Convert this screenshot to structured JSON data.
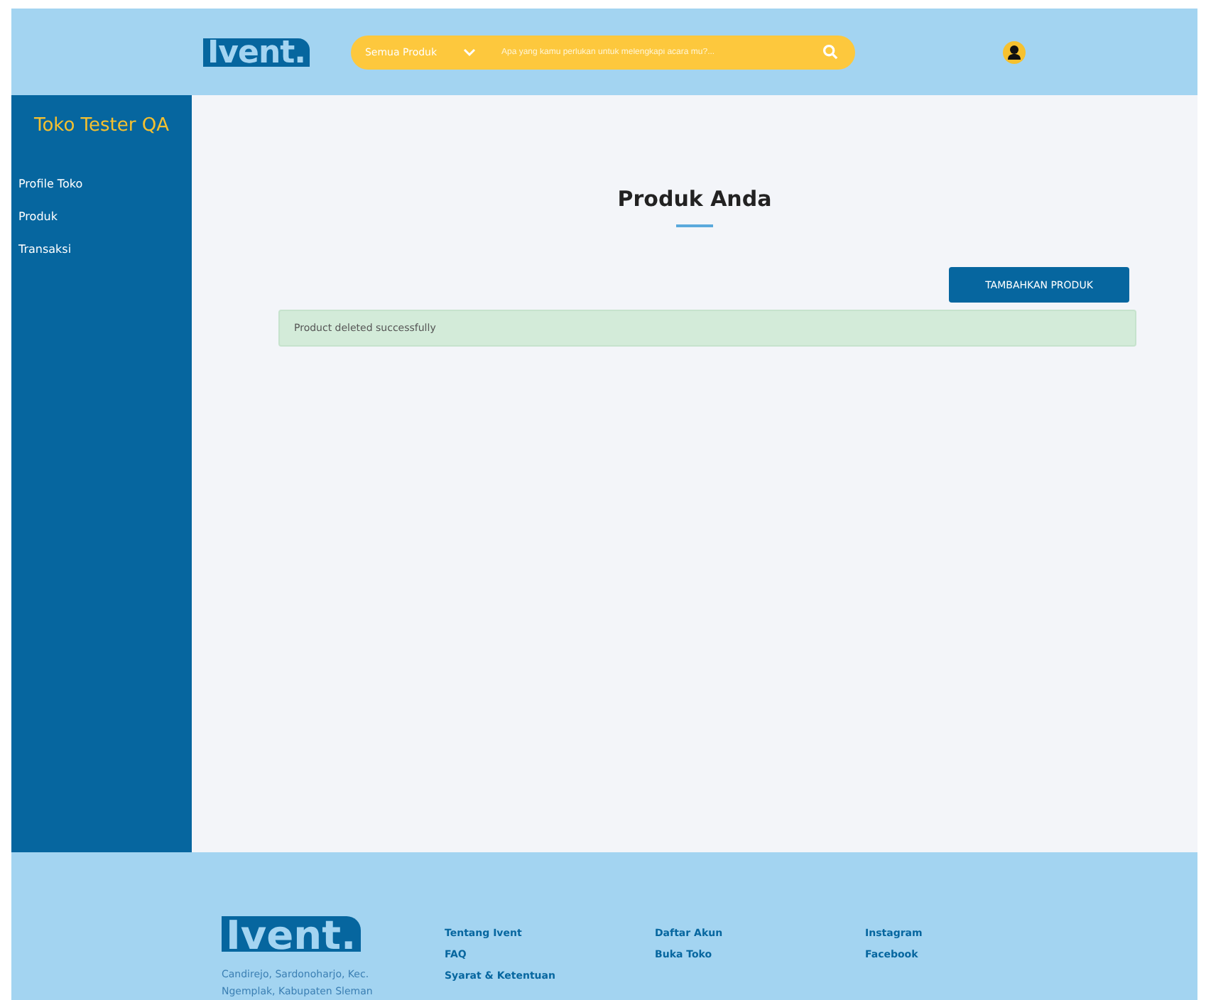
{
  "header": {
    "logo": "Ivent.",
    "search": {
      "category": "Semua Produk",
      "placeholder": "Apa yang kamu perlukan untuk melengkapi acara mu?..."
    }
  },
  "sidebar": {
    "store_name": "Toko Tester QA",
    "items": [
      {
        "label": "Profile Toko"
      },
      {
        "label": "Produk"
      },
      {
        "label": "Transaksi"
      }
    ]
  },
  "main": {
    "title": "Produk Anda",
    "add_button": "TAMBAHKAN PRODUK",
    "alert": "Product deleted successfully"
  },
  "footer": {
    "logo": "Ivent.",
    "address": "Candirejo, Sardonoharjo, Kec. Ngemplak, Kabupaten Sleman",
    "columns": [
      [
        "Tentang Ivent",
        "FAQ",
        "Syarat & Ketentuan"
      ],
      [
        "Daftar Akun",
        "Buka Toko"
      ],
      [
        "Instagram",
        "Facebook"
      ]
    ]
  }
}
